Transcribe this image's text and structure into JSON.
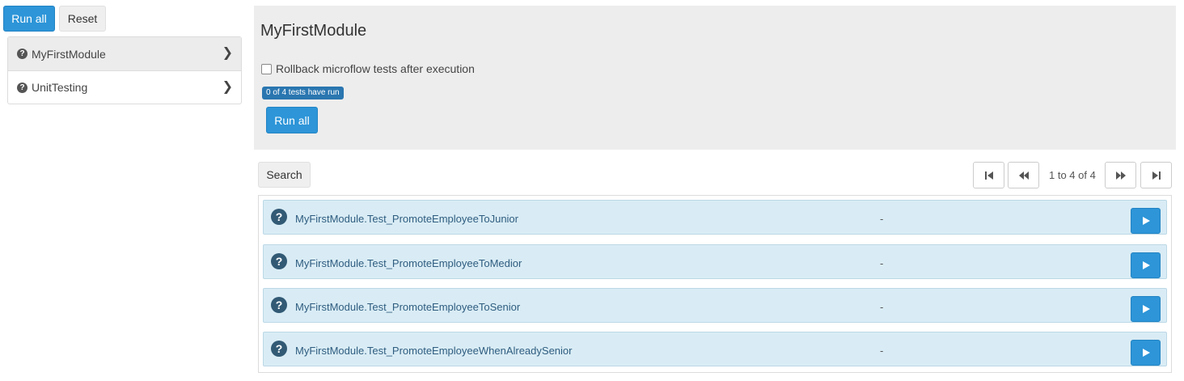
{
  "toolbar": {
    "run_all_label": "Run all",
    "reset_label": "Reset"
  },
  "sidebar": {
    "items": [
      {
        "label": "MyFirstModule",
        "status_icon": "question-icon",
        "active": true
      },
      {
        "label": "UnitTesting",
        "status_icon": "question-icon",
        "active": false
      }
    ]
  },
  "module": {
    "title": "MyFirstModule",
    "rollback_label": "Rollback microflow tests after execution",
    "rollback_checked": false,
    "progress_badge": "0 of 4 tests have run",
    "run_all_label": "Run all"
  },
  "list": {
    "search_label": "Search",
    "pager_text": "1 to 4 of 4"
  },
  "tests": [
    {
      "name": "MyFirstModule.Test_PromoteEmployeeToJunior",
      "result": "-"
    },
    {
      "name": "MyFirstModule.Test_PromoteEmployeeToMedior",
      "result": "-"
    },
    {
      "name": "MyFirstModule.Test_PromoteEmployeeToSenior",
      "result": "-"
    },
    {
      "name": "MyFirstModule.Test_PromoteEmployeeWhenAlreadySenior",
      "result": "-"
    }
  ],
  "colors": {
    "primary": "#2d95d8",
    "badge": "#2a76b0",
    "row_background": "#d9ecf5",
    "panel_background": "#ededed"
  }
}
